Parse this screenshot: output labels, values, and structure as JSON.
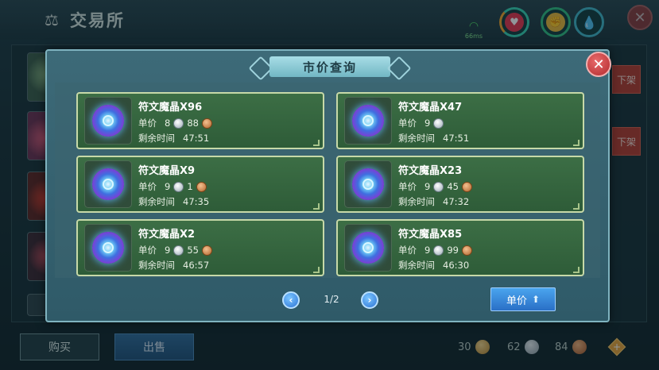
{
  "page": {
    "title": "交易所",
    "ping": "66ms",
    "buy_label": "购买",
    "sell_label": "出售",
    "offshelf_label": "下架",
    "currencies": [
      {
        "type": "gold",
        "amount": "30"
      },
      {
        "type": "silver",
        "amount": "62"
      },
      {
        "type": "copper",
        "amount": "84"
      }
    ],
    "status_icons": [
      "heart-icon",
      "arm-icon",
      "water-drop-icon"
    ]
  },
  "modal": {
    "title": "市价查询",
    "close_label": "✕",
    "price_label": "单价",
    "time_label": "剩余时间",
    "listings": [
      {
        "name": "符文魔晶X96",
        "silver": "8",
        "copper": "88",
        "time": "47:51"
      },
      {
        "name": "符文魔晶X47",
        "silver": "9",
        "copper": "",
        "time": "47:51"
      },
      {
        "name": "符文魔晶X9",
        "silver": "9",
        "copper": "1",
        "time": "47:35"
      },
      {
        "name": "符文魔晶X23",
        "silver": "9",
        "copper": "45",
        "time": "47:32"
      },
      {
        "name": "符文魔晶X2",
        "silver": "9",
        "copper": "55",
        "time": "46:57"
      },
      {
        "name": "符文魔晶X85",
        "silver": "9",
        "copper": "99",
        "time": "46:30"
      }
    ],
    "pagination": {
      "text": "1/2",
      "prev": "‹",
      "next": "›"
    },
    "sort_button_label": "单价"
  },
  "colors": {
    "listing_green": "#3c6e45",
    "close_red": "#b32a2e",
    "accent_blue": "#2a6fc6"
  }
}
